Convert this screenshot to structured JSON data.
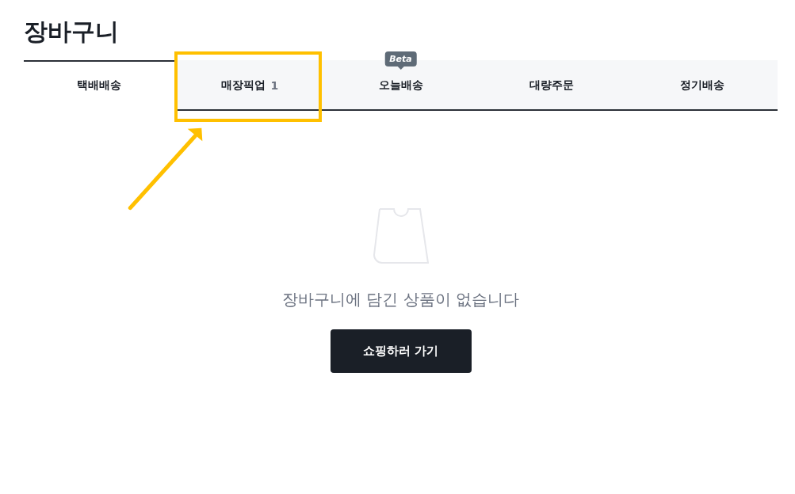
{
  "page": {
    "title": "장바구니"
  },
  "tabs": [
    {
      "label": "택배배송",
      "selected": true,
      "highlighted": false
    },
    {
      "label": "매장픽업",
      "count": "1",
      "selected": false,
      "highlighted": true
    },
    {
      "label": "오늘배송",
      "badge": "Beta",
      "selected": false,
      "highlighted": false
    },
    {
      "label": "대량주문",
      "selected": false,
      "highlighted": false
    },
    {
      "label": "정기배송",
      "selected": false,
      "highlighted": false
    }
  ],
  "empty_state": {
    "message": "장바구니에 담긴 상품이 없습니다",
    "button": "쇼핑하러 가기"
  }
}
